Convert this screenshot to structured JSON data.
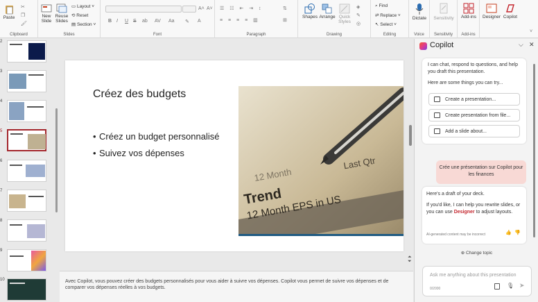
{
  "ribbon": {
    "clipboard": {
      "paste": "Paste",
      "group": "Clipboard"
    },
    "slides": {
      "new_slide": "New Slide",
      "reuse_slides": "Reuse Slides",
      "layout": "Layout",
      "reset": "Reset",
      "section": "Section",
      "group": "Slides"
    },
    "font": {
      "group": "Font",
      "bold": "B",
      "italic": "I",
      "underline": "U",
      "strike": "S"
    },
    "paragraph": {
      "group": "Paragraph"
    },
    "drawing": {
      "shapes": "Shapes",
      "arrange": "Arrange",
      "quick_styles": "Quick Styles",
      "group": "Drawing"
    },
    "editing": {
      "find": "Find",
      "replace": "Replace",
      "select": "Select",
      "group": "Editing"
    },
    "voice": {
      "dictate": "Dictate",
      "group": "Voice"
    },
    "sensitivity": {
      "label": "Sensitivity",
      "group": "Sensitivity"
    },
    "addins": {
      "label": "Add-ins",
      "group": "Add-ins"
    },
    "designer": "Designer",
    "copilot": "Copilot"
  },
  "thumbnails": {
    "numbers": [
      "2",
      "3",
      "4",
      "5",
      "6",
      "7",
      "8",
      "9",
      "10"
    ],
    "selected_index": 3
  },
  "slide": {
    "title": "Créez des budgets",
    "bullets": [
      "Créez un budget personnalisé",
      "Suivez vos dépenses"
    ],
    "photo_text": {
      "line1": "Trend",
      "line2": "12 Month  EPS in US",
      "line3": "12 Month",
      "line4": "Last Qtr"
    }
  },
  "notes": {
    "text": "Avec Copilot, vous pouvez créer des budgets personnalisés pour vous aider à suivre vos dépenses. Copilot vous permet de suivre vos dépenses et de comparer vos dépenses réelles à vos budgets."
  },
  "copilot": {
    "title": "Copilot",
    "intro": "I can chat, respond to questions, and help you draft this presentation.",
    "try_label": "Here are some things you can try...",
    "suggestions": [
      "Create a presentation...",
      "Create presentation from file...",
      "Add a slide about..."
    ],
    "user_message": "Crée une présentation sur Copilot pour les finances",
    "reply_line1": "Here's a draft of your deck.",
    "reply_line2_pre": "If you'd like, I can help you rewrite slides, or you can use ",
    "reply_link": "Designer",
    "reply_line2_post": " to adjust layouts.",
    "disclaimer": "AI-generated content may be incorrect",
    "change_topic": "Change topic",
    "input_placeholder": "Ask me anything about this presentation",
    "char_count": "0/2000"
  },
  "colors": {
    "accent": "#a4262c",
    "copilot_link": "#c4262e",
    "user_bubble": "#f8d9d5"
  }
}
